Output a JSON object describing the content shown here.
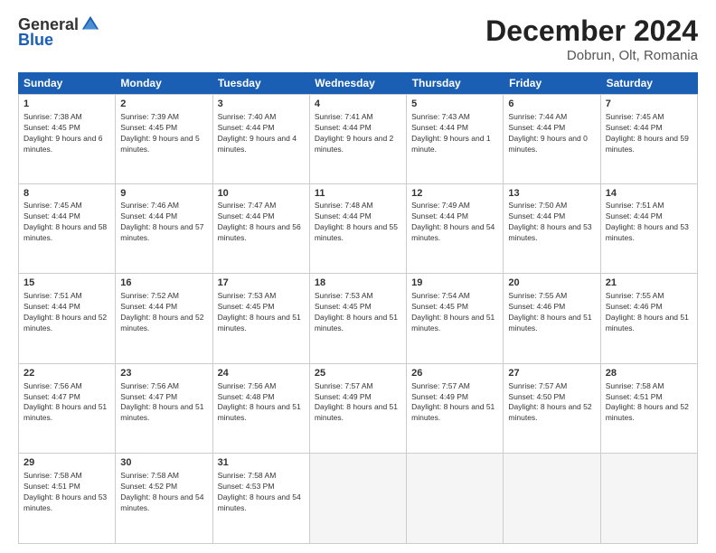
{
  "logo": {
    "general": "General",
    "blue": "Blue"
  },
  "title": "December 2024",
  "subtitle": "Dobrun, Olt, Romania",
  "weekdays": [
    "Sunday",
    "Monday",
    "Tuesday",
    "Wednesday",
    "Thursday",
    "Friday",
    "Saturday"
  ],
  "weeks": [
    [
      {
        "day": 1,
        "sunrise": "7:38 AM",
        "sunset": "4:45 PM",
        "daylight": "9 hours and 6 minutes."
      },
      {
        "day": 2,
        "sunrise": "7:39 AM",
        "sunset": "4:45 PM",
        "daylight": "9 hours and 5 minutes."
      },
      {
        "day": 3,
        "sunrise": "7:40 AM",
        "sunset": "4:44 PM",
        "daylight": "9 hours and 4 minutes."
      },
      {
        "day": 4,
        "sunrise": "7:41 AM",
        "sunset": "4:44 PM",
        "daylight": "9 hours and 2 minutes."
      },
      {
        "day": 5,
        "sunrise": "7:43 AM",
        "sunset": "4:44 PM",
        "daylight": "9 hours and 1 minute."
      },
      {
        "day": 6,
        "sunrise": "7:44 AM",
        "sunset": "4:44 PM",
        "daylight": "9 hours and 0 minutes."
      },
      {
        "day": 7,
        "sunrise": "7:45 AM",
        "sunset": "4:44 PM",
        "daylight": "8 hours and 59 minutes."
      }
    ],
    [
      {
        "day": 8,
        "sunrise": "7:45 AM",
        "sunset": "4:44 PM",
        "daylight": "8 hours and 58 minutes."
      },
      {
        "day": 9,
        "sunrise": "7:46 AM",
        "sunset": "4:44 PM",
        "daylight": "8 hours and 57 minutes."
      },
      {
        "day": 10,
        "sunrise": "7:47 AM",
        "sunset": "4:44 PM",
        "daylight": "8 hours and 56 minutes."
      },
      {
        "day": 11,
        "sunrise": "7:48 AM",
        "sunset": "4:44 PM",
        "daylight": "8 hours and 55 minutes."
      },
      {
        "day": 12,
        "sunrise": "7:49 AM",
        "sunset": "4:44 PM",
        "daylight": "8 hours and 54 minutes."
      },
      {
        "day": 13,
        "sunrise": "7:50 AM",
        "sunset": "4:44 PM",
        "daylight": "8 hours and 53 minutes."
      },
      {
        "day": 14,
        "sunrise": "7:51 AM",
        "sunset": "4:44 PM",
        "daylight": "8 hours and 53 minutes."
      }
    ],
    [
      {
        "day": 15,
        "sunrise": "7:51 AM",
        "sunset": "4:44 PM",
        "daylight": "8 hours and 52 minutes."
      },
      {
        "day": 16,
        "sunrise": "7:52 AM",
        "sunset": "4:44 PM",
        "daylight": "8 hours and 52 minutes."
      },
      {
        "day": 17,
        "sunrise": "7:53 AM",
        "sunset": "4:45 PM",
        "daylight": "8 hours and 51 minutes."
      },
      {
        "day": 18,
        "sunrise": "7:53 AM",
        "sunset": "4:45 PM",
        "daylight": "8 hours and 51 minutes."
      },
      {
        "day": 19,
        "sunrise": "7:54 AM",
        "sunset": "4:45 PM",
        "daylight": "8 hours and 51 minutes."
      },
      {
        "day": 20,
        "sunrise": "7:55 AM",
        "sunset": "4:46 PM",
        "daylight": "8 hours and 51 minutes."
      },
      {
        "day": 21,
        "sunrise": "7:55 AM",
        "sunset": "4:46 PM",
        "daylight": "8 hours and 51 minutes."
      }
    ],
    [
      {
        "day": 22,
        "sunrise": "7:56 AM",
        "sunset": "4:47 PM",
        "daylight": "8 hours and 51 minutes."
      },
      {
        "day": 23,
        "sunrise": "7:56 AM",
        "sunset": "4:47 PM",
        "daylight": "8 hours and 51 minutes."
      },
      {
        "day": 24,
        "sunrise": "7:56 AM",
        "sunset": "4:48 PM",
        "daylight": "8 hours and 51 minutes."
      },
      {
        "day": 25,
        "sunrise": "7:57 AM",
        "sunset": "4:49 PM",
        "daylight": "8 hours and 51 minutes."
      },
      {
        "day": 26,
        "sunrise": "7:57 AM",
        "sunset": "4:49 PM",
        "daylight": "8 hours and 51 minutes."
      },
      {
        "day": 27,
        "sunrise": "7:57 AM",
        "sunset": "4:50 PM",
        "daylight": "8 hours and 52 minutes."
      },
      {
        "day": 28,
        "sunrise": "7:58 AM",
        "sunset": "4:51 PM",
        "daylight": "8 hours and 52 minutes."
      }
    ],
    [
      {
        "day": 29,
        "sunrise": "7:58 AM",
        "sunset": "4:51 PM",
        "daylight": "8 hours and 53 minutes."
      },
      {
        "day": 30,
        "sunrise": "7:58 AM",
        "sunset": "4:52 PM",
        "daylight": "8 hours and 54 minutes."
      },
      {
        "day": 31,
        "sunrise": "7:58 AM",
        "sunset": "4:53 PM",
        "daylight": "8 hours and 54 minutes."
      },
      null,
      null,
      null,
      null
    ]
  ]
}
